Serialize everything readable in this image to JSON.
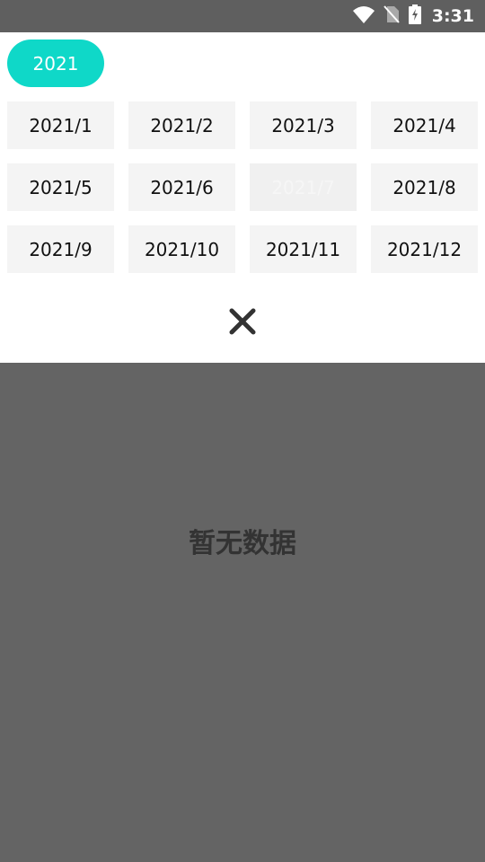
{
  "status_bar": {
    "time": "3:31",
    "icons": [
      "wifi-icon",
      "no-sim-icon",
      "battery-charging-icon"
    ]
  },
  "year_filter": {
    "selected_year": "2021",
    "accent_color": "#0fd8c8"
  },
  "months": [
    {
      "label": "2021/1"
    },
    {
      "label": "2021/2"
    },
    {
      "label": "2021/3"
    },
    {
      "label": "2021/4"
    },
    {
      "label": "2021/5"
    },
    {
      "label": "2021/6"
    },
    {
      "label": "2021/7",
      "selected": true
    },
    {
      "label": "2021/8"
    },
    {
      "label": "2021/9"
    },
    {
      "label": "2021/10"
    },
    {
      "label": "2021/11"
    },
    {
      "label": "2021/12"
    }
  ],
  "close_icon": "close-icon",
  "empty_state": {
    "text": "暂无数据"
  }
}
